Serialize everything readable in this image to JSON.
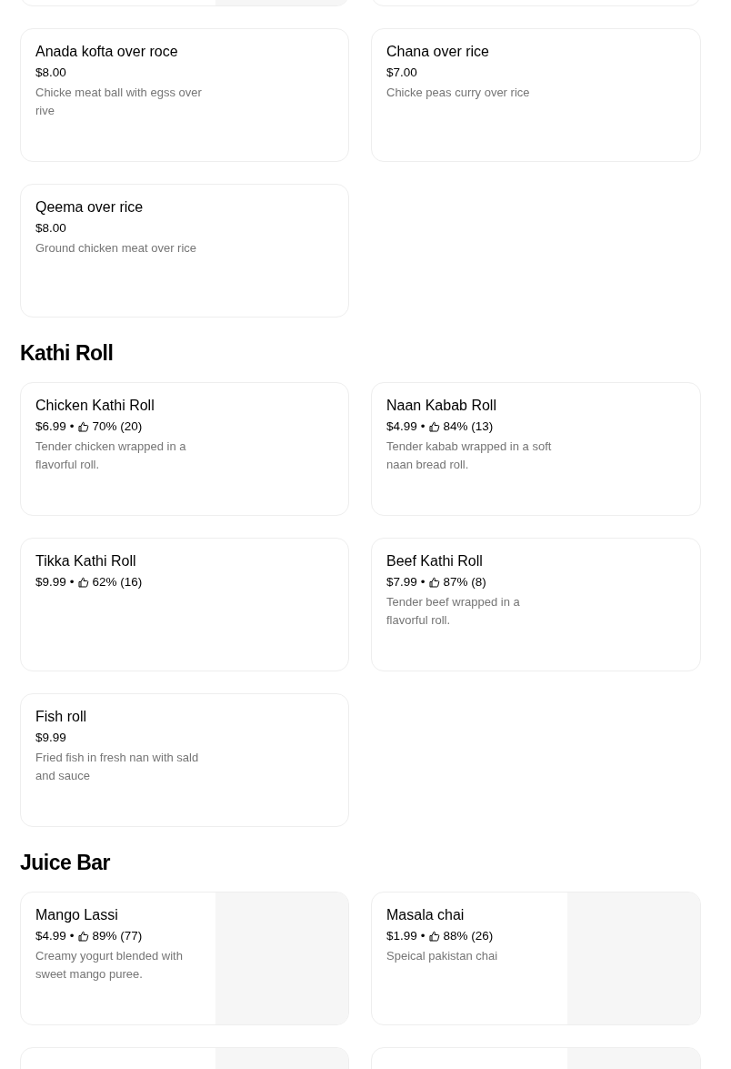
{
  "sections": [
    {
      "items": [
        {
          "kind": "photo"
        },
        {
          "kind": "plain"
        },
        {
          "name": "Anada kofta over roce",
          "price": "$8.00",
          "description": "Chicke meat ball with egss over rive",
          "kind": "plain"
        },
        {
          "name": "Chana over rice",
          "price": "$7.00",
          "description": "Chicke peas curry over rice",
          "kind": "plain"
        },
        {
          "name": "Qeema over rice",
          "price": "$8.00",
          "description": "Ground chicken meat over rice",
          "kind": "plain"
        }
      ]
    },
    {
      "heading": "Kathi Roll",
      "items": [
        {
          "name": "Chicken Kathi Roll",
          "price": "$6.99",
          "separator": "•",
          "rating": "70% (20)",
          "description": "Tender chicken wrapped in a flavorful roll.",
          "kind": "plain"
        },
        {
          "name": "Naan Kabab Roll",
          "price": "$4.99",
          "separator": "•",
          "rating": "84% (13)",
          "description": "Tender kabab wrapped in a soft naan bread roll.",
          "kind": "plain"
        },
        {
          "name": "Tikka Kathi Roll",
          "price": "$9.99",
          "separator": "•",
          "rating": "62% (16)",
          "kind": "plain"
        },
        {
          "name": "Beef Kathi Roll",
          "price": "$7.99",
          "separator": "•",
          "rating": "87% (8)",
          "description": "Tender beef wrapped in a flavorful roll.",
          "kind": "plain"
        },
        {
          "name": "Fish roll",
          "price": "$9.99",
          "description": "Fried fish in fresh nan with sald and sauce",
          "kind": "plain"
        }
      ]
    },
    {
      "heading": "Juice Bar",
      "items": [
        {
          "name": "Mango Lassi",
          "price": "$4.99",
          "separator": "•",
          "rating": "89% (77)",
          "description": "Creamy yogurt blended with sweet mango puree.",
          "kind": "photo"
        },
        {
          "name": "Masala chai",
          "price": "$1.99",
          "separator": "•",
          "rating": "88% (26)",
          "description": "Speical pakistan chai",
          "kind": "photo"
        },
        {
          "kind": "photo"
        },
        {
          "kind": "photo"
        }
      ]
    }
  ]
}
